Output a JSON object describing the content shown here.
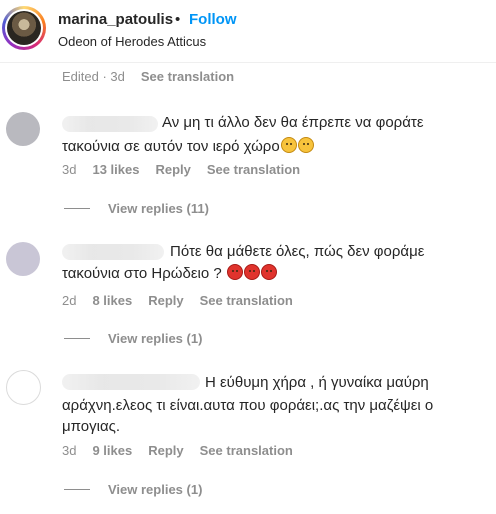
{
  "header": {
    "username": "marina_patoulis",
    "separator": "•",
    "follow_label": "Follow",
    "location": "Odeon of Herodes Atticus"
  },
  "caption_meta": {
    "edited": "Edited · 3d",
    "see_translation": "See translation"
  },
  "comments": [
    {
      "text_line1": "Αν μη τι άλλο δεν θα έπρεπε να φοράτε",
      "text_line2": "τακούνια σε αυτόν τον ιερό χώρο",
      "emojis": [
        "sad-face-emoji",
        "sad-face-emoji"
      ],
      "time": "3d",
      "likes": "13 likes",
      "reply": "Reply",
      "see_translation": "See translation",
      "view_replies": "View replies (11)",
      "avatar_color": "#b9b9bf"
    },
    {
      "text_line1": "Πότε θα μάθετε όλες, πώς δεν φοράμε",
      "text_line2": "τακούνια στο Ηρώδειο ?",
      "emojis": [
        "angry-face-emoji",
        "angry-face-emoji",
        "angry-face-emoji"
      ],
      "time": "2d",
      "likes": "8 likes",
      "reply": "Reply",
      "see_translation": "See translation",
      "view_replies": "View replies (1)",
      "avatar_color": "#c9c6d6"
    },
    {
      "text_line1": "Η εύθυμη χήρα , ή γυναίκα μαύρη",
      "text_line2": "αράχνη.ελεος τι είναι.αυτα που φοράει;.ας την μαζέψει ο",
      "text_line3": "μπογιας.",
      "time": "3d",
      "likes": "9 likes",
      "reply": "Reply",
      "see_translation": "See translation",
      "view_replies": "View replies (1)",
      "avatar_color": "#e3e3e3"
    }
  ]
}
